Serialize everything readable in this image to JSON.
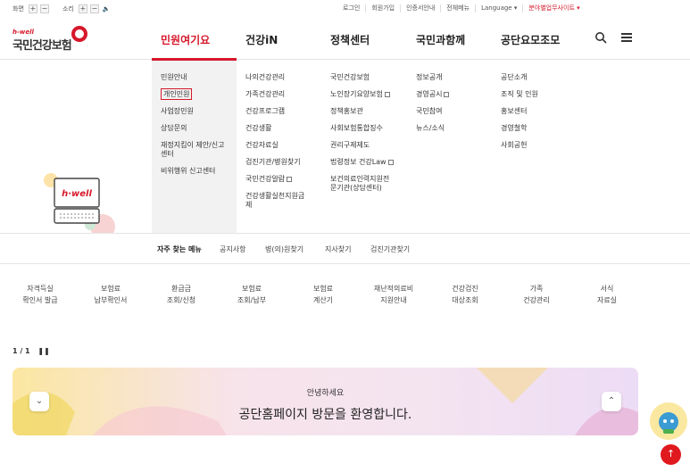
{
  "topbar": {
    "screen_label": "화면",
    "sound_label": "소리",
    "plus": "+",
    "minus": "−",
    "speaker": "🔈",
    "links": [
      "로그인",
      "회원가입",
      "인증서안내",
      "전체메뉴",
      "Language ▾"
    ],
    "business_site": "분야별업무사이트 ▾"
  },
  "logo": {
    "small": "h-well",
    "big": "국민건강보험"
  },
  "gnb": [
    "민원여기요",
    "건강iN",
    "정책센터",
    "국민과함께",
    "공단요모조모"
  ],
  "mega": {
    "col1": [
      "민원안내",
      "개인민원",
      "사업장민원",
      "상담문의",
      "재정지킴이 제안/신고",
      "센터",
      "비위행위 신고센터"
    ],
    "col2": [
      "나의건강관리",
      "가족건강관리",
      "건강프로그램",
      "건강생활",
      "건강자료실",
      "검진기관/병원찾기",
      "국민건강알람",
      "건강생활실천지원금",
      "제"
    ],
    "col3": [
      "국민건강보험",
      "노인장기요양보험",
      "정책홍보관",
      "사회보험통합징수",
      "권리구제제도",
      "법령정보 건강Law",
      "보건의료인력지원전",
      "문기관(상담센터)"
    ],
    "col4": [
      "정보공개",
      "경영공시",
      "국민참여",
      "뉴스/소식"
    ],
    "col5": [
      "공단소개",
      "조직 및 인원",
      "홍보센터",
      "경영철학",
      "사회공헌"
    ],
    "illus_text": "h·well"
  },
  "quick": {
    "label": "자주 찾는 메뉴",
    "items": [
      "공지사항",
      "병(의)원찾기",
      "지사찾기",
      "검진기관찾기"
    ]
  },
  "services": [
    [
      "자격득실",
      "확인서 발급"
    ],
    [
      "보험료",
      "납부확인서"
    ],
    [
      "환급금",
      "조회/신청"
    ],
    [
      "보험료",
      "조회/납부"
    ],
    [
      "보험료",
      "계산기"
    ],
    [
      "재난적의료비",
      "지원안내"
    ],
    [
      "건강검진",
      "대상조회"
    ],
    [
      "가족",
      "건강관리"
    ],
    [
      "서식",
      "자료실"
    ]
  ],
  "banner": {
    "pager": "1 / 1",
    "pause": "❚❚",
    "greeting": "안녕하세요",
    "welcome": "공단홈페이지 방문을 환영합니다.",
    "down_icon": "⌄",
    "up_icon": "⌃"
  },
  "top_button": "↑",
  "colors": {
    "accent": "#d6182b"
  }
}
